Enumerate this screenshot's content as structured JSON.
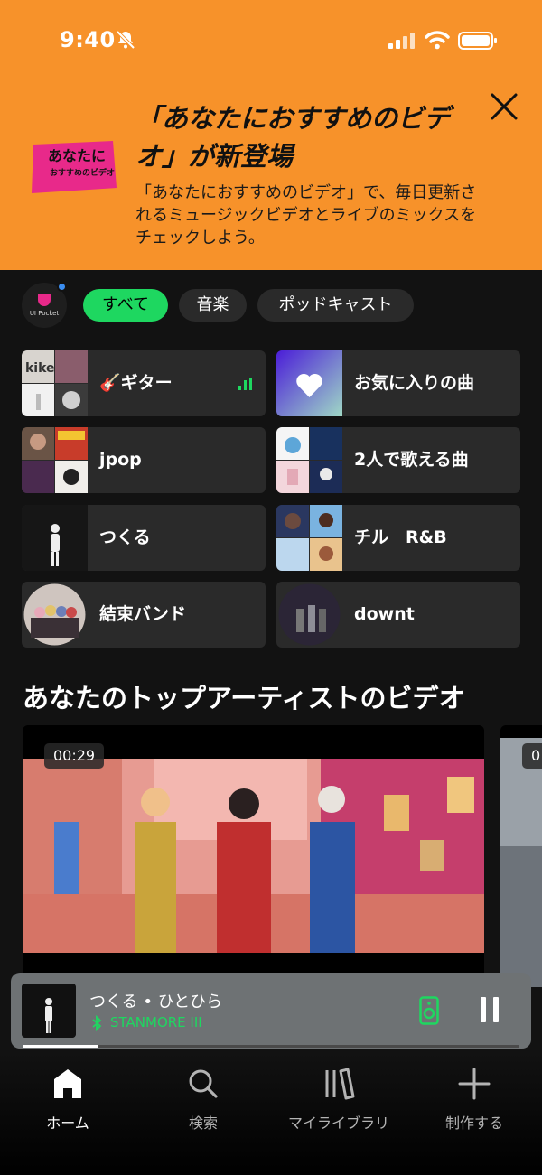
{
  "status_bar": {
    "time": "9:40"
  },
  "banner": {
    "title": "「あなたにおすすめのビデオ」が新登場",
    "description": "「あなたにおすすめのビデオ」で、毎日更新されるミュージックビデオとライブのミックスをチェックしよう。",
    "logo_line1": "あなたに",
    "logo_line2": "おすすめのビデオ",
    "brand_color": "#f7922a"
  },
  "profile": {
    "label": "UI Pocket"
  },
  "filters": [
    {
      "label": "すべて",
      "active": true
    },
    {
      "label": "音楽",
      "active": false
    },
    {
      "label": "ポッドキャスト",
      "active": false
    }
  ],
  "shortcuts": [
    {
      "label": "🎸ギター",
      "playing": true
    },
    {
      "label": "お気に入りの曲"
    },
    {
      "label": "jpop"
    },
    {
      "label": "2人で歌える曲"
    },
    {
      "label": "つくる"
    },
    {
      "label": "チル　R&B"
    },
    {
      "label": "結束バンド"
    },
    {
      "label": "downt"
    }
  ],
  "section": {
    "title": "あなたのトップアーティストのビデオ"
  },
  "videos": [
    {
      "duration": "00:29"
    },
    {
      "duration": "0"
    }
  ],
  "now_playing": {
    "title": "つくる • ひとひら",
    "device": "STANMORE III",
    "accent_color": "#1ed760",
    "progress": 0.15
  },
  "nav": [
    {
      "label": "ホーム",
      "icon": "home-icon",
      "active": true
    },
    {
      "label": "検索",
      "icon": "search-icon"
    },
    {
      "label": "マイライブラリ",
      "icon": "library-icon"
    },
    {
      "label": "制作する",
      "icon": "plus-icon"
    }
  ]
}
